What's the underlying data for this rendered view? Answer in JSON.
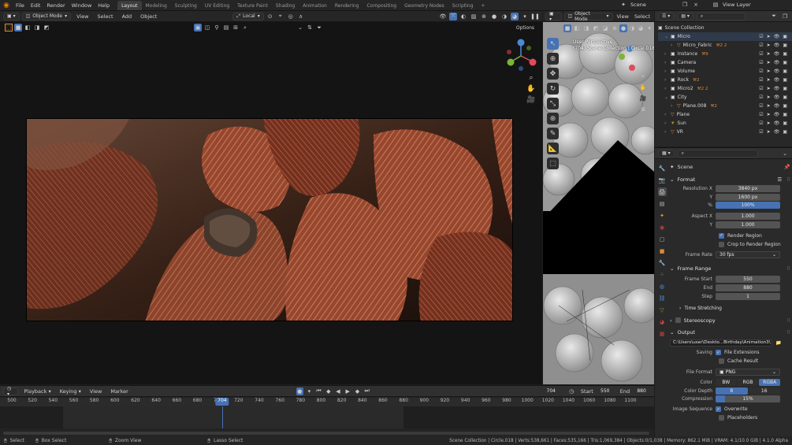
{
  "menubar": {
    "items": [
      "File",
      "Edit",
      "Render",
      "Window",
      "Help"
    ],
    "workspaces": [
      "Layout",
      "Modeling",
      "Sculpting",
      "UV Editing",
      "Texture Paint",
      "Shading",
      "Animation",
      "Rendering",
      "Compositing",
      "Geometry Nodes",
      "Scripting"
    ],
    "active_workspace": "Layout",
    "add_tab": "+",
    "scene": "Scene",
    "view_layer": "View Layer"
  },
  "viewport": {
    "mode": "Object Mode",
    "menus": [
      "View",
      "Select",
      "Add",
      "Object"
    ],
    "transform": "Local",
    "options": "Options"
  },
  "view3d_small": {
    "mode": "Object Mode",
    "menus": [
      "View",
      "Select"
    ],
    "overlay_line1": "User Perspective",
    "overlay_line2": "(704) Scene Collection | Circle.018"
  },
  "outliner": {
    "root": "Scene Collection",
    "items": [
      {
        "name": "Micro",
        "type": "collection",
        "expanded": true
      },
      {
        "name": "Micro_Fabric",
        "type": "object",
        "extras": "2 2"
      },
      {
        "name": "Instance",
        "type": "collection",
        "extras": "9"
      },
      {
        "name": "Camera",
        "type": "collection"
      },
      {
        "name": "Volume",
        "type": "collection"
      },
      {
        "name": "Rock",
        "type": "collection",
        "extras": "2"
      },
      {
        "name": "Micro2",
        "type": "collection",
        "extras": "2 2"
      },
      {
        "name": "City",
        "type": "collection",
        "expanded": true
      },
      {
        "name": "Plane.008",
        "type": "object",
        "extras": "2"
      },
      {
        "name": "Plane",
        "type": "object"
      },
      {
        "name": "Sun",
        "type": "light"
      },
      {
        "name": "VR",
        "type": "object"
      }
    ]
  },
  "properties": {
    "context": "Scene",
    "format": {
      "title": "Format",
      "res_x_label": "Resolution X",
      "res_x": "3840 px",
      "res_y_label": "Y",
      "res_y": "1600 px",
      "res_pct_label": "%",
      "res_pct": "100%",
      "aspect_x_label": "Aspect X",
      "aspect_x": "1.000",
      "aspect_y_label": "Y",
      "aspect_y": "1.000",
      "render_region": "Render Region",
      "crop_region": "Crop to Render Region",
      "frame_rate_label": "Frame Rate",
      "frame_rate": "30 fps"
    },
    "frame_range": {
      "title": "Frame Range",
      "start_label": "Frame Start",
      "start": "550",
      "end_label": "End",
      "end": "880",
      "step_label": "Step",
      "step": "1",
      "time_stretching": "Time Stretching",
      "stereoscopy": "Stereoscopy"
    },
    "output": {
      "title": "Output",
      "path": "C:\\Users\\user\\Deskto...Birthday\\Animation3\\",
      "saving_label": "Saving",
      "file_extensions": "File Extensions",
      "cache_result": "Cache Result",
      "file_format_label": "File Format",
      "file_format": "PNG",
      "color_label": "Color",
      "color_opts": [
        "BW",
        "RGB",
        "RGBA"
      ],
      "color_active": "RGBA",
      "depth_label": "Color Depth",
      "depth_opts": [
        "8",
        "16"
      ],
      "depth_active": "8",
      "compression_label": "Compression",
      "compression": "15%",
      "image_sequence_label": "Image Sequence",
      "overwrite": "Overwrite",
      "placeholders": "Placeholders"
    }
  },
  "timeline": {
    "menus": [
      "Playback",
      "Keying",
      "View",
      "Marker"
    ],
    "current_frame": "704",
    "start_label": "Start",
    "start": "550",
    "end_label": "End",
    "end": "880",
    "ticks": [
      "500",
      "520",
      "540",
      "560",
      "580",
      "600",
      "620",
      "640",
      "660",
      "680",
      "700",
      "720",
      "740",
      "760",
      "780",
      "800",
      "820",
      "840",
      "860",
      "880",
      "900",
      "920",
      "940",
      "960",
      "980",
      "1000",
      "1020",
      "1040",
      "1060",
      "1080",
      "1100"
    ],
    "playhead": "704"
  },
  "statusbar": {
    "select": "Select",
    "box_select": "Box Select",
    "zoom_view": "Zoom View",
    "lasso_select": "Lasso Select",
    "stats": "Scene Collection | Circle.018 | Verts:538,661 | Faces:535,166 | Tris:1,069,384 | Objects:0/1,038 | Memory: 862.1 MiB | VRAM: 4.1/10.0 GiB | 4.1.0 Alpha"
  },
  "colors": {
    "accent": "#4772b3",
    "bg": "#1d1d1d",
    "panel": "#303030",
    "playhead": "#4772b3"
  }
}
